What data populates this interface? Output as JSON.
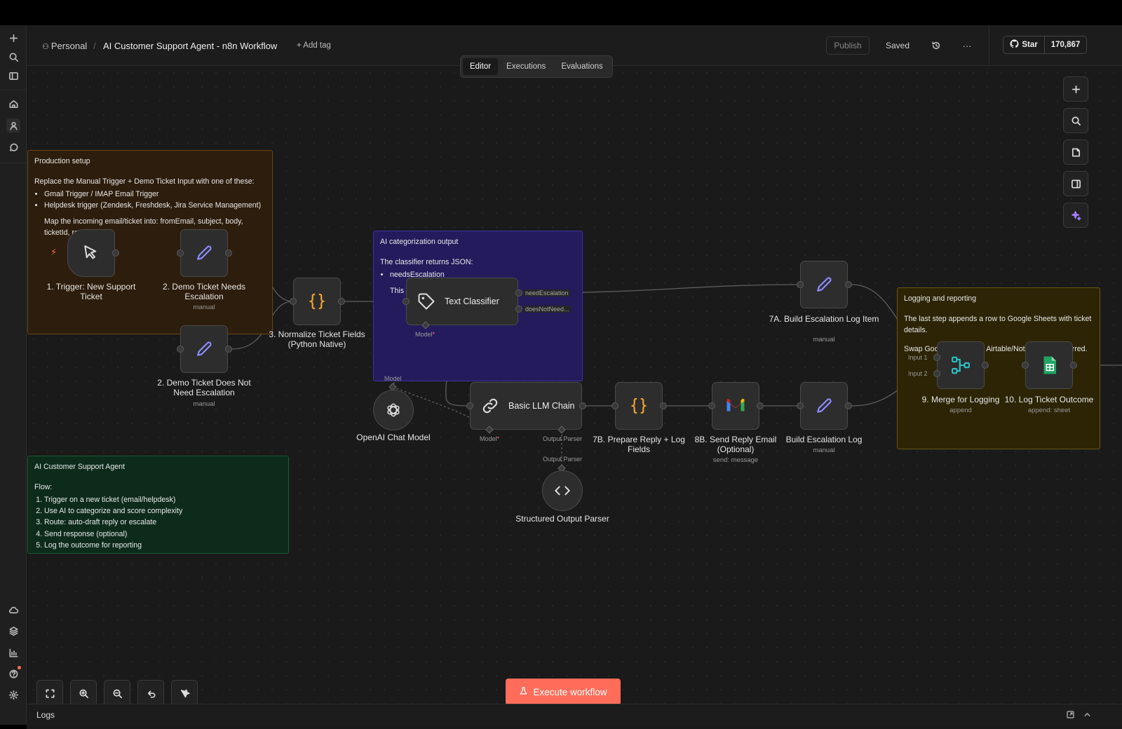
{
  "colors": {
    "accent": "#ff6d5a",
    "canvas": "#1a1a1a",
    "note_orange": "#2d1d0c",
    "note_purple": "#231b5c",
    "note_green": "#0d2b1b",
    "note_yellow": "#2c2405",
    "pencil": "#8b8bff",
    "code": "#f0a030",
    "merge": "#2bc2c7",
    "sheets": "#1fa463"
  },
  "header": {
    "project": "Personal",
    "separator": "/",
    "workflow_title": "AI Customer Support Agent - n8n Workflow",
    "add_tag": "+ Add tag",
    "publish": "Publish",
    "saved": "Saved",
    "more": "···",
    "github_star": "Star",
    "github_count": "170,867"
  },
  "tabs": [
    {
      "label": "Editor"
    },
    {
      "label": "Executions"
    },
    {
      "label": "Evaluations"
    }
  ],
  "stickies": {
    "production": {
      "title": "Production setup",
      "intro": "Replace the Manual Trigger + Demo Ticket Input with one of these:",
      "items": [
        "Gmail Trigger / IMAP Email Trigger",
        "Helpdesk trigger (Zendesk, Freshdesk, Jira Service Management)"
      ],
      "note": "Map the incoming email/ticket into: fromEmail, subject, body, ticketId, receivedAt."
    },
    "categorization": {
      "title": "AI categorization output",
      "intro": "The classifier returns JSON:",
      "items": [
        "needsEscalation"
      ],
      "note": "This drives the routing decision!"
    },
    "agent": {
      "title": "AI Customer Support Agent",
      "intro": "Flow:",
      "items": [
        "Trigger on a new ticket (email/helpdesk)",
        "Use AI to categorize and score complexity",
        "Route: auto-draft reply or escalate",
        "Send response (optional)",
        "Log the outcome for reporting"
      ]
    },
    "logging": {
      "title": "Logging and reporting",
      "intro": "The last step appends a row to Google Sheets with ticket details.",
      "note": "Swap Google Sheets for Airtable/Notion/DB if preferred."
    }
  },
  "nodes": {
    "trigger": {
      "label": "1. Trigger: New Support Ticket"
    },
    "demo_escalation": {
      "label": "2. Demo Ticket Needs Escalation",
      "sub": "manual"
    },
    "demo_no_escalation": {
      "label": "2. Demo Ticket Does Not Need Escalation",
      "sub": "manual"
    },
    "normalize": {
      "label": "3. Normalize Ticket Fields (Python Native)"
    },
    "classifier": {
      "label": "Text Classifier",
      "out1": "needEscalation",
      "out2": "doesNotNeed...",
      "model_port": "Model",
      "req": "*"
    },
    "openai": {
      "label": "OpenAI Chat Model",
      "port": "Model"
    },
    "llm_chain": {
      "label": "Basic LLM Chain",
      "model_port": "Model",
      "req": "*",
      "parser_port": "Output Parser"
    },
    "parser": {
      "label": "Structured Output Parser",
      "port": "Output Parser"
    },
    "prepare_reply": {
      "label": "7B. Prepare Reply + Log Fields"
    },
    "send_reply": {
      "label": "8B. Send Reply Email (Optional)",
      "sub": "send: message"
    },
    "build_escalation": {
      "label": "Build Escalation Log",
      "sub": "manual"
    },
    "build_escalation_item": {
      "label": "7A. Build Escalation Log Item",
      "sub": "manual"
    },
    "merge": {
      "label": "9. Merge for Logging",
      "sub": "append",
      "in1": "Input 1",
      "in2": "Input 2"
    },
    "log_outcome": {
      "label": "10. Log Ticket Outcome",
      "sub": "append: sheet"
    }
  },
  "execute_button": "Execute workflow",
  "logs": {
    "label": "Logs"
  }
}
